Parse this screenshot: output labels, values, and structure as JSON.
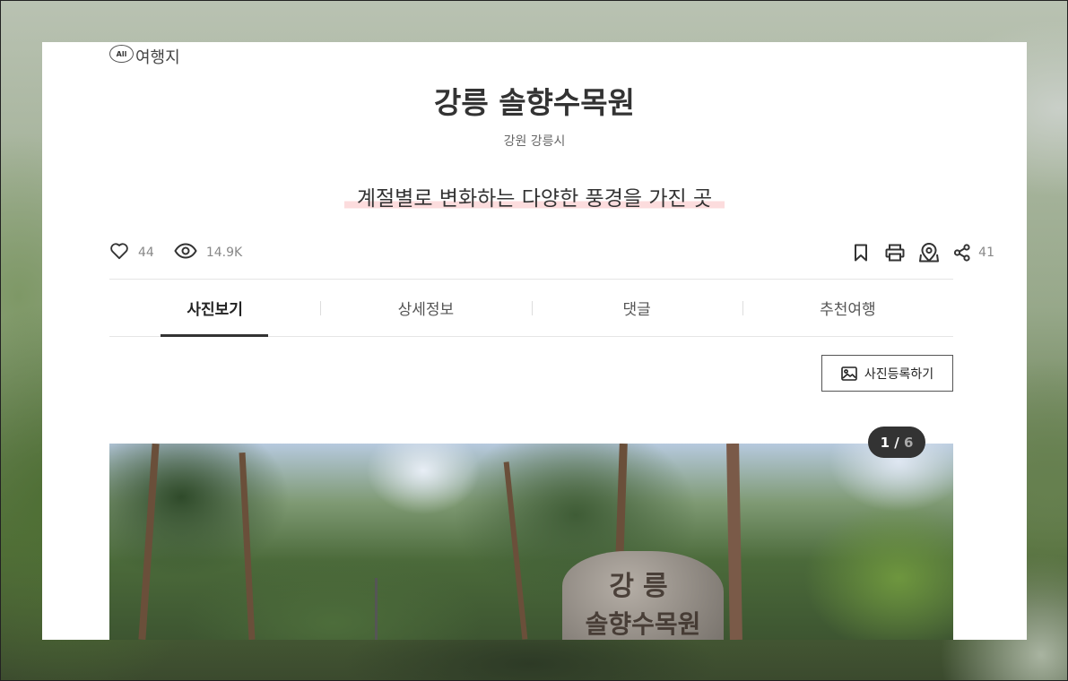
{
  "category": {
    "badge": "All",
    "label": "여행지"
  },
  "title": "강릉 솔향수목원",
  "region": "강원 강릉시",
  "tagline": "계절별로 변화하는 다양한 풍경을 가진 곳",
  "stats": {
    "likes": "44",
    "views": "14.9K",
    "shares": "41"
  },
  "actions": [
    "bookmark-icon",
    "print-icon",
    "map-pin-icon",
    "share-icon"
  ],
  "tabs": [
    {
      "label": "사진보기",
      "active": true
    },
    {
      "label": "상세정보",
      "active": false
    },
    {
      "label": "댓글",
      "active": false
    },
    {
      "label": "추천여행",
      "active": false
    }
  ],
  "upload": {
    "label": "사진등록하기"
  },
  "gallery": {
    "current": "1",
    "separator": " / ",
    "total": "6"
  },
  "photo_sign": {
    "line1": "강릉",
    "line2": "솔향수목원"
  }
}
